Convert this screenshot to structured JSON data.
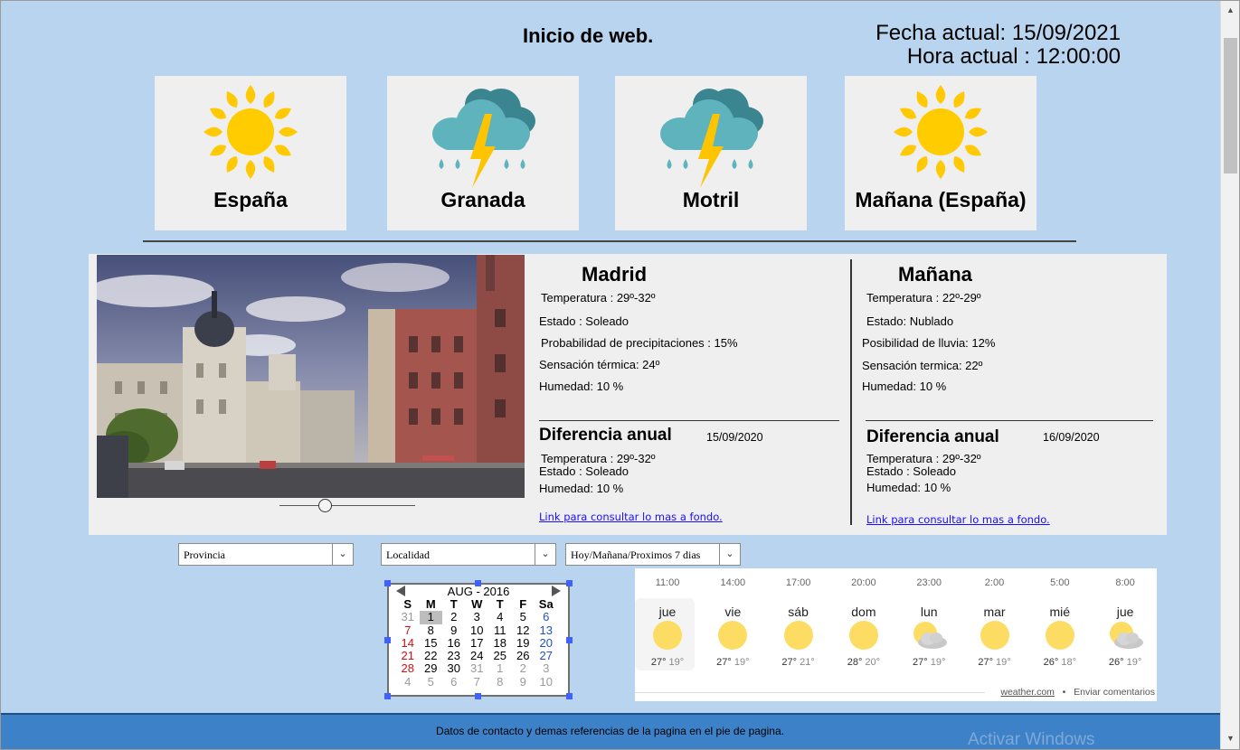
{
  "header": {
    "title": "Inicio de web.",
    "date_line": "Fecha actual: 15/09/2021",
    "time_line": "Hora actual : 12:00:00"
  },
  "cards": [
    {
      "label": "España",
      "icon": "sun-icon"
    },
    {
      "label": "Granada",
      "icon": "storm-cloud-icon"
    },
    {
      "label": "Motril",
      "icon": "storm-cloud-icon"
    },
    {
      "label": "Mañana (España)",
      "icon": "sun-icon"
    }
  ],
  "madrid": {
    "title": "Madrid",
    "temp": "Temperatura : 29º-32º",
    "estado": "Estado : Soleado",
    "precip": "Probabilidad de precipitaciones : 15%",
    "sensacion": "Sensación térmica: 24º",
    "humedad": "Humedad: 10 %",
    "diff_title": "Diferencia anual",
    "diff_date": "15/09/2020",
    "diff_temp": "Temperatura : 29º-32º",
    "diff_estado": "Estado : Soleado",
    "diff_humedad": "Humedad: 10 %",
    "link": "Link para consultar lo mas a fondo."
  },
  "manana": {
    "title": "Mañana",
    "temp": "Temperatura : 22º-29º",
    "estado": "Estado: Nublado",
    "lluvia": "Posibilidad de lluvia: 12%",
    "sensacion": "Sensación termica: 22º",
    "humedad": "Humedad: 10 %",
    "diff_title": "Diferencia anual",
    "diff_date": "16/09/2020",
    "diff_temp": "Temperatura : 29º-32º",
    "diff_estado": "Estado : Soleado",
    "diff_humedad": "Humedad: 10 %",
    "link": "Link para consultar lo mas a fondo."
  },
  "slider_value": 0.33,
  "selects": {
    "provincia": "Provincia",
    "localidad": "Localidad",
    "periodo": "Hoy/Mañana/Proximos 7 dias"
  },
  "calendar": {
    "month": "AUG - 2016",
    "days_header": [
      "S",
      "M",
      "T",
      "W",
      "T",
      "F",
      "Sa"
    ],
    "weeks": [
      [
        "31",
        "1",
        "2",
        "3",
        "4",
        "5",
        "6"
      ],
      [
        "7",
        "8",
        "9",
        "10",
        "11",
        "12",
        "13"
      ],
      [
        "14",
        "15",
        "16",
        "17",
        "18",
        "19",
        "20"
      ],
      [
        "21",
        "22",
        "23",
        "24",
        "25",
        "26",
        "27"
      ],
      [
        "28",
        "29",
        "30",
        "31",
        "1",
        "2",
        "3"
      ],
      [
        "4",
        "5",
        "6",
        "7",
        "8",
        "9",
        "10"
      ]
    ]
  },
  "forecast": [
    {
      "time": "11:00",
      "day": "jue",
      "icon": "sun-icon",
      "hi": "27°",
      "lo": "19°"
    },
    {
      "time": "14:00",
      "day": "vie",
      "icon": "sun-icon",
      "hi": "27°",
      "lo": "19°"
    },
    {
      "time": "17:00",
      "day": "sáb",
      "icon": "sun-icon",
      "hi": "27°",
      "lo": "21°"
    },
    {
      "time": "20:00",
      "day": "dom",
      "icon": "sun-icon",
      "hi": "28°",
      "lo": "20°"
    },
    {
      "time": "23:00",
      "day": "lun",
      "icon": "partly-cloudy-icon",
      "hi": "27°",
      "lo": "19°"
    },
    {
      "time": "2:00",
      "day": "mar",
      "icon": "sun-icon",
      "hi": "27°",
      "lo": "19°"
    },
    {
      "time": "5:00",
      "day": "mié",
      "icon": "sun-icon",
      "hi": "26°",
      "lo": "18°"
    },
    {
      "time": "8:00",
      "day": "jue",
      "icon": "partly-cloudy-icon",
      "hi": "26°",
      "lo": "19°"
    }
  ],
  "widget_footer": {
    "source": "weather.com",
    "sep": "•",
    "feedback": "Enviar comentarios"
  },
  "footer_text": "Datos de contacto y demas referencias de la pagina en el pie de pagina.",
  "watermark": "Activar Windows",
  "colors": {
    "background": "#b8d4ee",
    "footer": "#3d82c8",
    "sun": "#ffcc00",
    "cloud": "#5fb3bd",
    "bolt": "#ffc400"
  }
}
